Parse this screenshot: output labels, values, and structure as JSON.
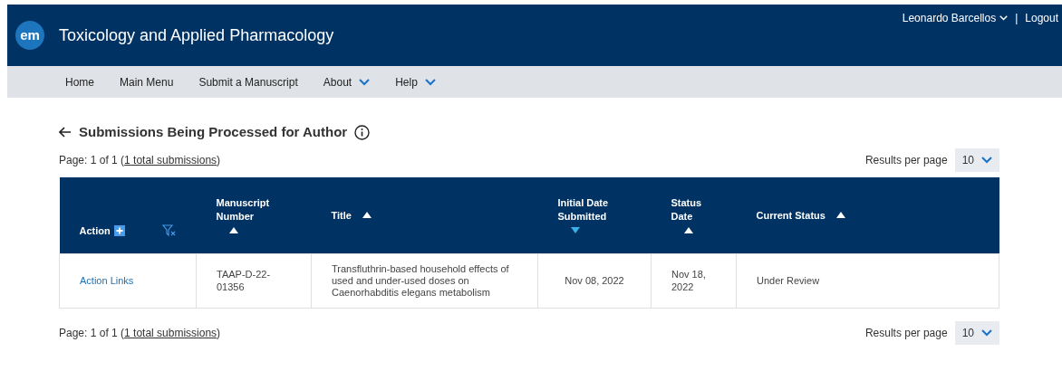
{
  "header": {
    "logo": "em",
    "journal": "Toxicology and Applied Pharmacology",
    "user": "Leonardo Barcellos",
    "separator": "|",
    "logout": "Logout"
  },
  "nav": [
    {
      "label": "Home",
      "dropdown": false
    },
    {
      "label": "Main Menu",
      "dropdown": false
    },
    {
      "label": "Submit a Manuscript",
      "dropdown": false
    },
    {
      "label": "About",
      "dropdown": true
    },
    {
      "label": "Help",
      "dropdown": true
    }
  ],
  "page_title": "Submissions Being Processed for Author",
  "pagination_top": {
    "prefix": "Page: 1 of 1 (",
    "link": "1 total submissions",
    "suffix": ")",
    "results_label": "Results per page",
    "results_value": "10"
  },
  "table": {
    "columns": [
      {
        "label": "Action",
        "kind": "unsorted"
      },
      {
        "label": "Manuscript Number",
        "kind": "asc"
      },
      {
        "label": "Title",
        "kind": "asc"
      },
      {
        "label": "Initial Date Submitted",
        "kind": "desc"
      },
      {
        "label": "Status Date",
        "kind": "asc"
      },
      {
        "label": "Current Status",
        "kind": "asc"
      }
    ],
    "rows": [
      {
        "action": "Action Links",
        "manuscript_number": "TAAP-D-22-01356",
        "title": "Transfluthrin-based household effects of used and under-used doses on Caenorhabditis elegans metabolism",
        "initial_date": "Nov 08, 2022",
        "status_date": "Nov 18, 2022",
        "status": "Under Review"
      }
    ]
  },
  "pagination_bottom": {
    "prefix": "Page: 1 of 1 (",
    "link": "1 total submissions",
    "suffix": ")",
    "results_label": "Results per page",
    "results_value": "10"
  }
}
